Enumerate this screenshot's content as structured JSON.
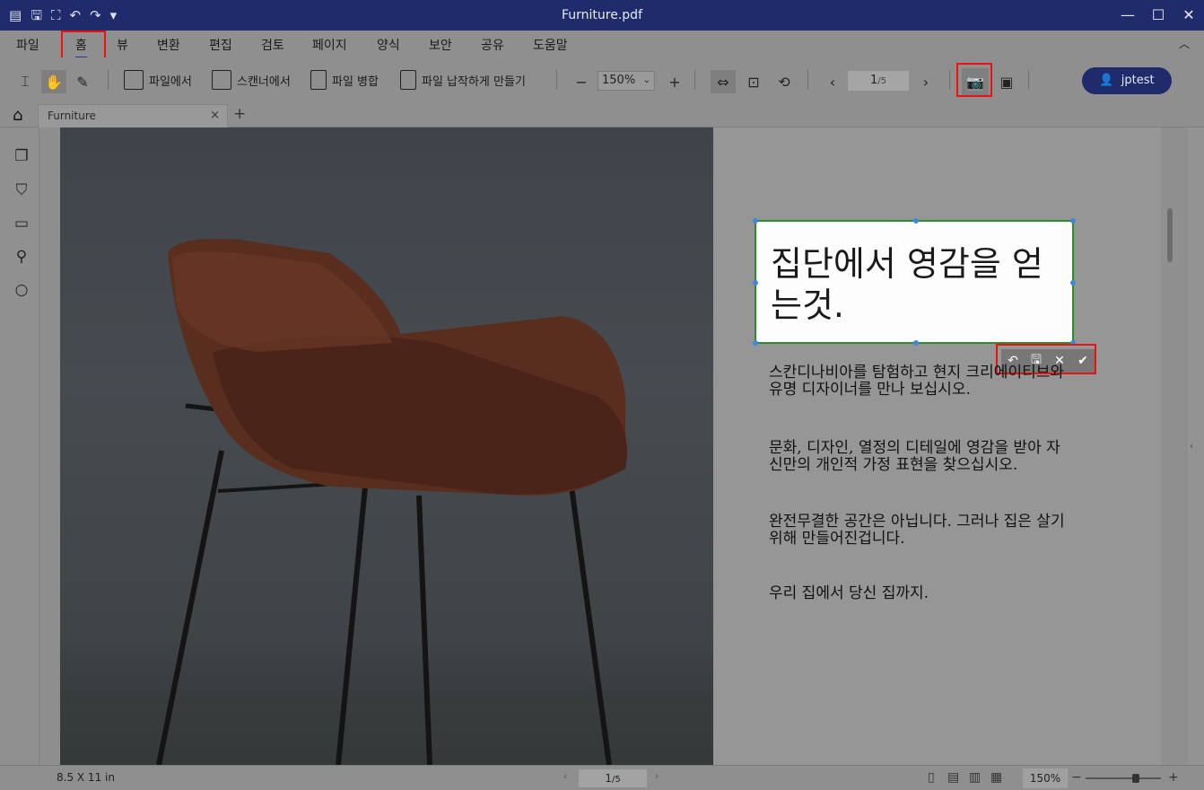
{
  "window": {
    "title": "Furniture.pdf",
    "quick_access": [
      "menu-icon",
      "save-icon",
      "fit-icon",
      "undo-icon",
      "redo-icon",
      "dropdown-icon"
    ],
    "controls": [
      "—",
      "☐",
      "✕"
    ]
  },
  "menu": {
    "items": [
      "파일",
      "홈",
      "뷰",
      "변환",
      "편집",
      "검토",
      "페이지",
      "양식",
      "보안",
      "공유",
      "도움말"
    ],
    "active": "홈"
  },
  "toolbar": {
    "from_file": "파일에서",
    "from_scanner": "스캔너에서",
    "merge": "파일 병합",
    "compress": "파일 납작하게 만들기",
    "zoom_minus": "−",
    "zoom_value": "150%",
    "zoom_plus": "+",
    "page_current": "1",
    "page_total": "/5",
    "prev": "‹",
    "next": "›",
    "user_name": "jptest"
  },
  "tabs": {
    "doc_tab": "Furniture",
    "close": "×",
    "add": "+"
  },
  "document": {
    "headline": "집단에서 영감을 얻는것.",
    "paragraphs": [
      "스칸디나비아를 탐험하고 현지 크리에이티브와 유명 디자이너를 만나 보십시오.",
      "문화, 디자인, 열정의 디테일에 영감을 받아 자신만의 개인적 가정 표현을 찾으십시오.",
      "완전무결한 공간은 아닙니다. 그러나 집은 살기 위해 만들어진겁니다.",
      "우리 집에서 당신 집까지."
    ],
    "edit_tools": [
      "↶",
      "🖫",
      "✕",
      "✔"
    ]
  },
  "status": {
    "page_size": "8.5 X 11 in",
    "page_current": "1",
    "page_total": "/5",
    "zoom": "150%",
    "zoom_minus": "−",
    "zoom_plus": "+"
  }
}
